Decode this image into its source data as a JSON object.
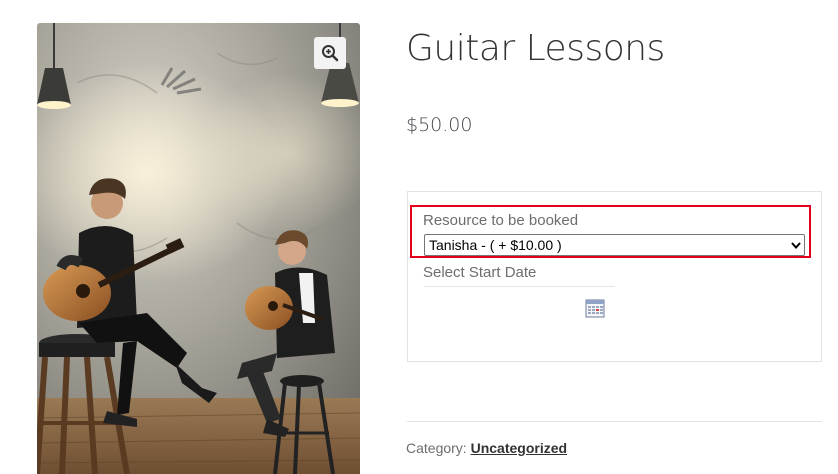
{
  "product": {
    "title": "Guitar Lessons",
    "price": "$50.00",
    "image_alt": "Two guitarists seated on stools playing acoustic guitars"
  },
  "booking_form": {
    "resource_label": "Resource to be booked",
    "resource_selected": "Tanisha - ( + $10.00 )",
    "start_date_label": "Select Start Date",
    "start_date_value": ""
  },
  "meta": {
    "category_prefix": "Category: ",
    "category_link": "Uncategorized"
  },
  "icons": {
    "zoom": "magnifier-plus-icon",
    "select_arrow": "chevron-down-icon",
    "calendar": "calendar-icon"
  },
  "colors": {
    "highlight": "#e4001b",
    "text": "#43454b",
    "title": "#333333",
    "muted": "#6d6d6d"
  }
}
